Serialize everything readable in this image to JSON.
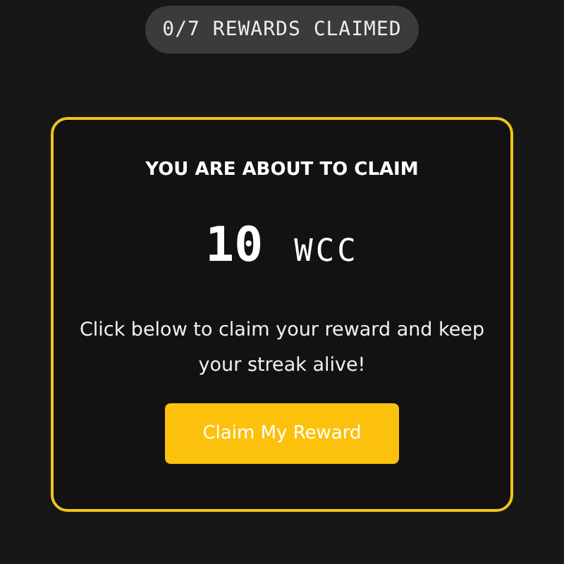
{
  "progress_badge": "0/7 REWARDS CLAIMED",
  "card": {
    "heading": "YOU ARE ABOUT TO CLAIM",
    "amount": "10",
    "currency": "WCC",
    "message": "Click below to claim your reward and keep your streak alive!",
    "button": "Claim My Reward"
  }
}
